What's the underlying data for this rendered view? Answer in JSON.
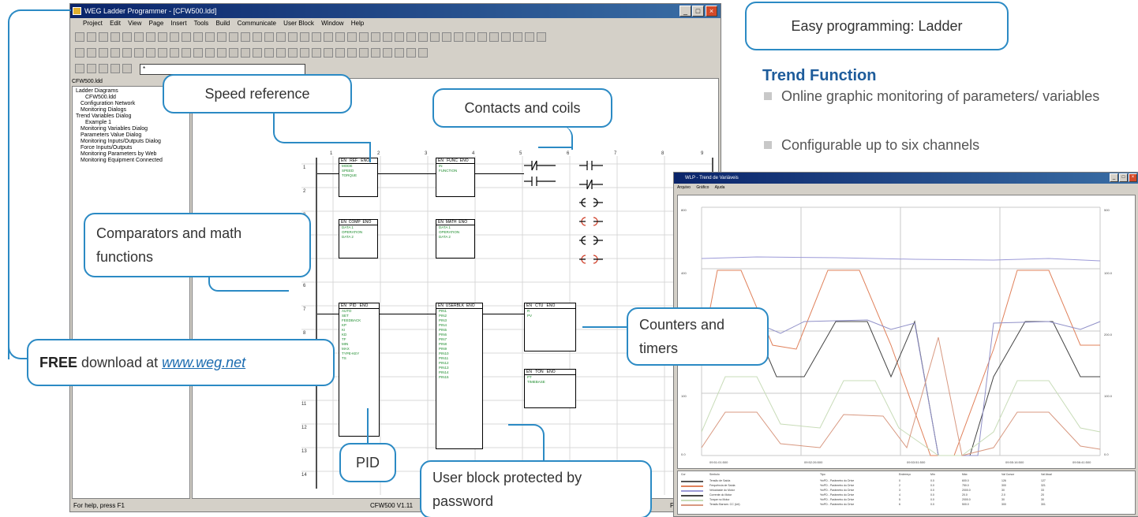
{
  "main_window": {
    "title": "WEG Ladder Programmer - [CFW500.ldd]",
    "menu": [
      "Project",
      "Edit",
      "View",
      "Page",
      "Insert",
      "Tools",
      "Build",
      "Communicate",
      "User Block",
      "Window",
      "Help"
    ],
    "combo_value": "*",
    "tree_title": "CFW500.ldd",
    "tree_items": [
      "Ladder Diagrams",
      "CFW500.ldd",
      "Configuration Network",
      "Monitoring Dialogs",
      "Trend Variables Dialog",
      "Example 1",
      "Monitoring Variables Dialog",
      "Parameters Value Dialog",
      "Monitoring Inputs/Outputs Dialog",
      "Force Inputs/Outputs",
      "Monitoring Parameters by Web",
      "Monitoring Equipment Connected"
    ],
    "status_left": "For help, press F1",
    "status_center": "CFW500 V1.11",
    "status_right": "Page"
  },
  "callouts": {
    "easy_programming": "Easy programming: Ladder",
    "speed_reference": "Speed reference",
    "contacts_and_coils": "Contacts and coils",
    "comparators": "Comparators and math functions",
    "counters_timers": "Counters and timers",
    "free_bold": "FREE",
    "free_rest": " download at ",
    "free_link": "www.weg.net",
    "pid": "PID",
    "user_block": "User block protected by password"
  },
  "trend_function": {
    "heading": "Trend Function",
    "bullets": [
      "Online graphic monitoring of parameters/ variables",
      "Configurable up to six channels"
    ]
  },
  "trend_window": {
    "title": "WLP - Trend de Variáveis",
    "menu": [
      "Arquivo",
      "Gráfico",
      "Ajuda"
    ],
    "table_headers": [
      "Cor",
      "Símbolo",
      "Tipo",
      "Endereço",
      "Mín",
      "Máx",
      "Val Cursor",
      "Val Atual"
    ],
    "table_rows": [
      [
        "Tensão de Saída",
        "%xPD - Parâmetro do Drive",
        "0",
        "0.0",
        "600.0",
        "126",
        "127"
      ],
      [
        "Frequência de Saída",
        "%xPD - Parâmetro do Drive",
        "2",
        "0.0",
        "750.0",
        "300",
        "321"
      ],
      [
        "Velocidade do Motor",
        "%xPD - Parâmetro do Drive",
        "3",
        "0.0",
        "2000.0",
        "30",
        "33"
      ],
      [
        "Corrente do Motor",
        "%xPD - Parâmetro do Drive",
        "4",
        "0.0",
        "20.0",
        "2.0",
        "20"
      ],
      [
        "Torque no Motor",
        "%xPD - Parâmetro do Drive",
        "5",
        "0.0",
        "2000.0",
        "30",
        "30"
      ],
      [
        "Tensão Barram. CC (Ud)",
        "%xPD - Parâmetro do Drive",
        "6",
        "0.0",
        "500.0",
        "300",
        "301"
      ]
    ],
    "colors": [
      "#555555",
      "#e0805a",
      "#9c9ad8",
      "#444444",
      "#c8dcb8",
      "#d89880"
    ]
  }
}
